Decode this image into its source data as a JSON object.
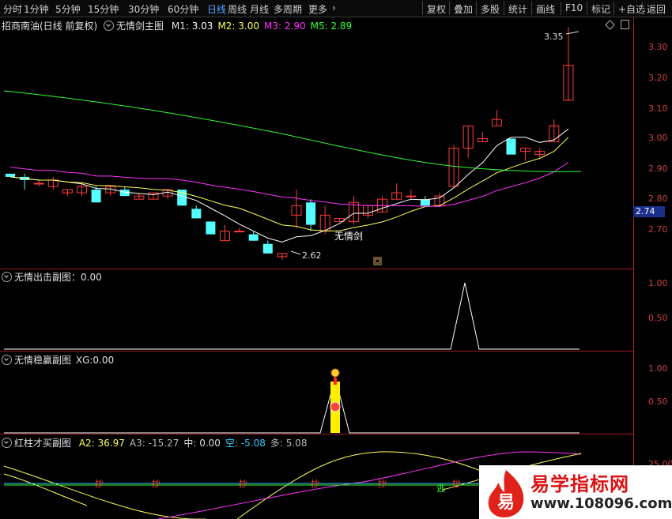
{
  "toolbar": {
    "left": [
      "分时",
      "1分钟",
      "5分钟",
      "15分钟",
      "30分钟",
      "60分钟",
      "日线",
      "周线",
      "月线",
      "多周期",
      "更多"
    ],
    "active": "日线",
    "right": [
      "复权",
      "叠加",
      "多股",
      "统计",
      "画线",
      "F10",
      "标记",
      "+自选",
      "返回"
    ]
  },
  "main_panel": {
    "stock": "招商南油(日线 前复权)",
    "indicator": "无情剑主图",
    "ma": [
      {
        "label": "M1:",
        "value": "3.03",
        "color": "#ffffff"
      },
      {
        "label": "M2:",
        "value": "3.00",
        "color": "#ffff55"
      },
      {
        "label": "M3:",
        "value": "2.90",
        "color": "#ff33ff"
      },
      {
        "label": "M5:",
        "value": "2.89",
        "color": "#33ff33"
      }
    ],
    "high_label": "3.35",
    "low_label": "2.62",
    "annotation": "无情剑",
    "price_tag": "2.74",
    "ticks": [
      "3.30",
      "3.20",
      "3.10",
      "3.00",
      "2.90",
      "2.80",
      "2.70"
    ]
  },
  "sub1": {
    "title": "无情出击副图",
    "value": "：0.00",
    "ticks": [
      "1.00",
      "0.50"
    ]
  },
  "sub2": {
    "title": "无情稳赢副图",
    "label": "XG:",
    "value": "0.00",
    "ticks": [
      "1.00",
      "0.50"
    ]
  },
  "sub3": {
    "title": "红柱才买副图",
    "values": [
      {
        "label": "A2:",
        "value": "36.97",
        "color": "#ffff55"
      },
      {
        "label": "A3:",
        "value": "-15.27",
        "color": "#bbbbbb"
      },
      {
        "label": "中:",
        "value": "0.00",
        "color": "#dddddd"
      },
      {
        "label": "空:",
        "value": "-5.08",
        "color": "#33ccff"
      },
      {
        "label": "多:",
        "value": "5.08",
        "color": "#bbbbbb"
      }
    ],
    "tick": "25.00",
    "signals": [
      "抄",
      "抄",
      "抄",
      "抄",
      "抄",
      "抄"
    ],
    "signal_green": "逃"
  },
  "watermark": {
    "name": "易学指标网",
    "url": "www.108096.com",
    "glyph": "易"
  },
  "chart_data": {
    "type": "candlestick",
    "ylim": [
      2.6,
      3.38
    ],
    "candles": [
      [
        2.89,
        2.88,
        2.89,
        2.88
      ],
      [
        2.88,
        2.87,
        2.89,
        2.84
      ],
      [
        2.86,
        2.86,
        2.87,
        2.85
      ],
      [
        2.85,
        2.87,
        2.88,
        2.84
      ],
      [
        2.83,
        2.84,
        2.84,
        2.82
      ],
      [
        2.83,
        2.85,
        2.86,
        2.82
      ],
      [
        2.84,
        2.8,
        2.85,
        2.8
      ],
      [
        2.83,
        2.85,
        2.85,
        2.82
      ],
      [
        2.84,
        2.82,
        2.85,
        2.82
      ],
      [
        2.81,
        2.82,
        2.83,
        2.81
      ],
      [
        2.81,
        2.83,
        2.83,
        2.81
      ],
      [
        2.82,
        2.84,
        2.84,
        2.81
      ],
      [
        2.84,
        2.79,
        2.84,
        2.79
      ],
      [
        2.78,
        2.75,
        2.79,
        2.75
      ],
      [
        2.74,
        2.7,
        2.74,
        2.7
      ],
      [
        2.68,
        2.71,
        2.73,
        2.68
      ],
      [
        2.71,
        2.71,
        2.72,
        2.71
      ],
      [
        2.7,
        2.68,
        2.71,
        2.68
      ],
      [
        2.67,
        2.64,
        2.68,
        2.64
      ],
      [
        2.63,
        2.64,
        2.64,
        2.62
      ],
      [
        2.76,
        2.79,
        2.84,
        2.72
      ],
      [
        2.8,
        2.73,
        2.81,
        2.71
      ],
      [
        2.71,
        2.76,
        2.79,
        2.7
      ],
      [
        2.74,
        2.75,
        2.75,
        2.74
      ],
      [
        2.74,
        2.8,
        2.82,
        2.73
      ],
      [
        2.76,
        2.79,
        2.79,
        2.75
      ],
      [
        2.77,
        2.81,
        2.82,
        2.77
      ],
      [
        2.81,
        2.83,
        2.86,
        2.81
      ],
      [
        2.82,
        2.82,
        2.84,
        2.81
      ],
      [
        2.81,
        2.79,
        2.82,
        2.79
      ],
      [
        2.79,
        2.82,
        2.83,
        2.79
      ],
      [
        2.85,
        2.97,
        2.98,
        2.85
      ],
      [
        2.97,
        3.04,
        3.04,
        2.94
      ],
      [
        2.99,
        3.0,
        3.02,
        2.99
      ],
      [
        3.04,
        3.06,
        3.09,
        3.04
      ],
      [
        3.0,
        2.95,
        3.0,
        2.95
      ],
      [
        2.96,
        2.97,
        2.97,
        2.93
      ],
      [
        2.95,
        2.96,
        2.97,
        2.94
      ],
      [
        2.99,
        3.04,
        3.06,
        2.99
      ],
      [
        3.12,
        3.23,
        3.35,
        3.12
      ]
    ]
  }
}
